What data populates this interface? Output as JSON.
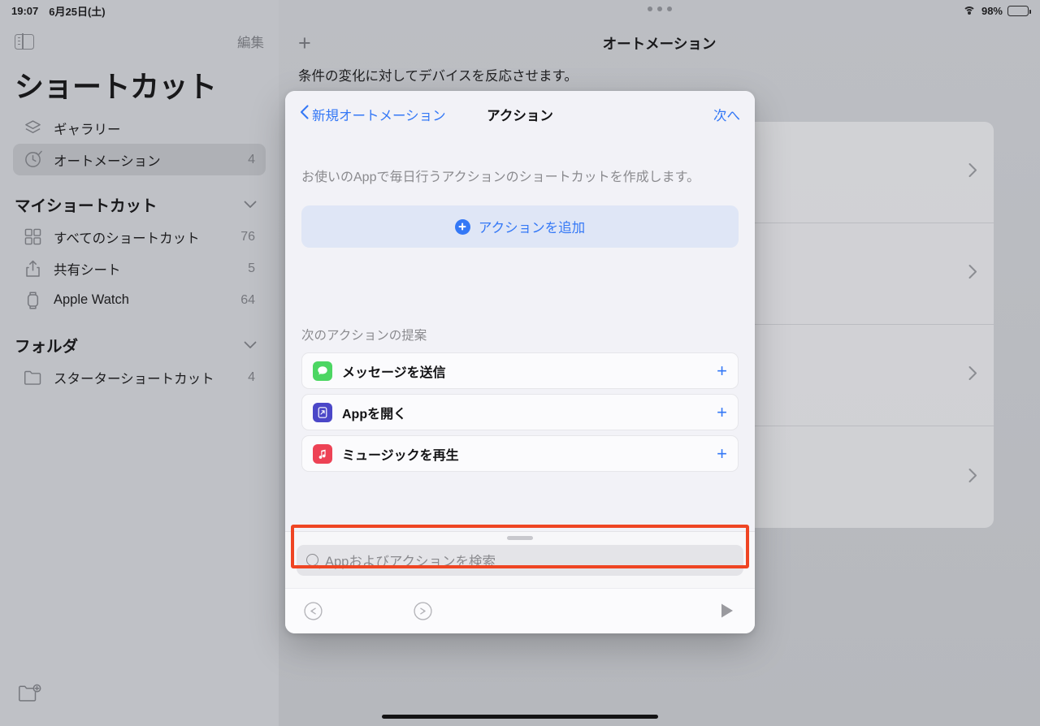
{
  "statusbar": {
    "time": "19:07",
    "date": "6月25日(土)",
    "battery_percent": "98%",
    "wifi_icon": "wifi-icon",
    "battery_icon": "battery-icon"
  },
  "sidebar": {
    "toggle_icon": "sidebar-toggle-icon",
    "edit_label": "編集",
    "title": "ショートカット",
    "new_folder_icon": "folder-plus-icon",
    "items": [
      {
        "label": "ギャラリー",
        "count": "",
        "icon": "gallery-icon",
        "selected": false
      },
      {
        "label": "オートメーション",
        "count": "4",
        "icon": "clock-check-icon",
        "selected": true
      }
    ],
    "sections": [
      {
        "label": "マイショートカット",
        "chevron": "chevron-down-icon",
        "items": [
          {
            "label": "すべてのショートカット",
            "count": "76",
            "icon": "grid-icon"
          },
          {
            "label": "共有シート",
            "count": "5",
            "icon": "share-icon"
          },
          {
            "label": "Apple Watch",
            "count": "64",
            "icon": "watch-icon"
          }
        ]
      },
      {
        "label": "フォルダ",
        "chevron": "chevron-down-icon",
        "items": [
          {
            "label": "スターターショートカット",
            "count": "4",
            "icon": "folder-icon"
          }
        ]
      }
    ]
  },
  "main": {
    "multitask_handle_icon": "multitask-dots-icon",
    "add_button_icon": "plus-icon",
    "title": "オートメーション",
    "subtitle": "条件の変化に対してデバイスを反応させます。",
    "rows": [
      {
        "chevron": "chevron-right-icon"
      },
      {
        "chevron": "chevron-right-icon"
      },
      {
        "chevron": "chevron-right-icon"
      },
      {
        "chevron": "chevron-right-icon"
      }
    ]
  },
  "modal": {
    "back_label": "新規オートメーション",
    "back_icon": "chevron-left-icon",
    "title": "アクション",
    "next_label": "次へ",
    "description": "お使いのAppで毎日行うアクションのショートカットを作成します。",
    "add_action": {
      "label": "アクションを追加",
      "icon": "plus-circle-icon"
    },
    "suggestions_title": "次のアクションの提案",
    "suggestions": [
      {
        "label": "メッセージを送信",
        "icon": "messages-app-icon",
        "color": "#4cd662",
        "add_icon": "plus-icon"
      },
      {
        "label": "Appを開く",
        "icon": "open-app-icon",
        "color": "#4b47c8",
        "add_icon": "plus-icon"
      },
      {
        "label": "ミュージックを再生",
        "icon": "music-app-icon",
        "color": "#ed4255",
        "add_icon": "plus-icon"
      }
    ],
    "search": {
      "placeholder": "Appおよびアクションを検索",
      "value": "",
      "icon": "search-icon",
      "highlight_color": "#ef4523"
    },
    "toolbar": {
      "undo_icon": "undo-icon",
      "redo_icon": "redo-icon",
      "run_icon": "play-icon"
    },
    "grabber_icon": "sheet-grabber-icon"
  },
  "accent_color": "#3478f6"
}
